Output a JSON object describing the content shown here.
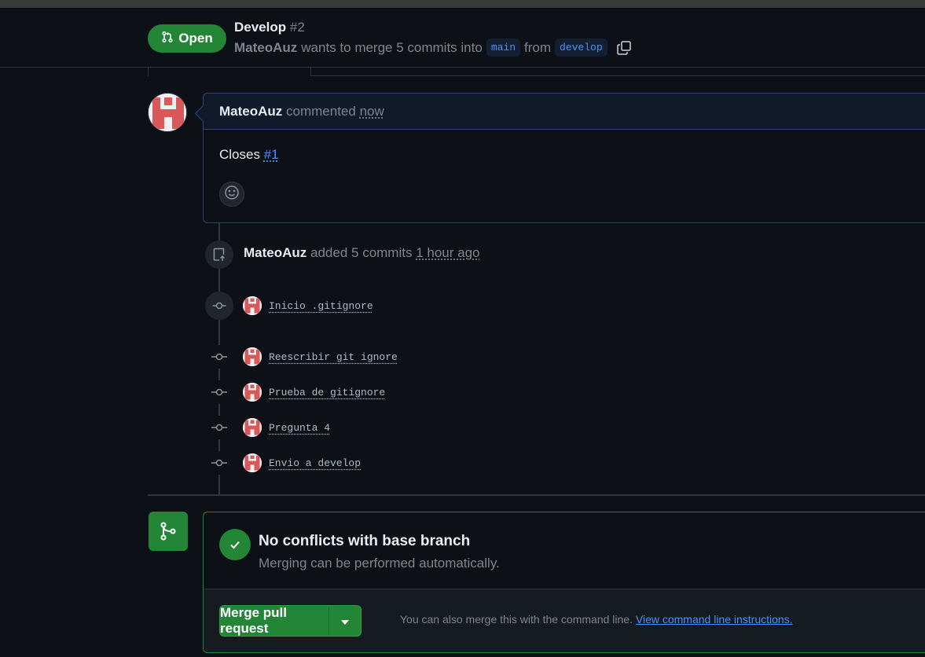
{
  "pr": {
    "state": "Open",
    "title": "Develop",
    "number": "#2",
    "author": "MateoAuz",
    "merge_text": "wants to merge 5 commits into",
    "base_branch": "main",
    "from_text": "from",
    "head_branch": "develop"
  },
  "comment": {
    "author": "MateoAuz",
    "action": "commented",
    "time": "now",
    "body_text": "Closes",
    "issue_link": "#1"
  },
  "event": {
    "author": "MateoAuz",
    "action": "added 5 commits",
    "time": "1 hour ago"
  },
  "commits": [
    {
      "message": "Inicio .gitignore"
    },
    {
      "message": "Reescribir git ignore"
    },
    {
      "message": "Prueba de gitignore"
    },
    {
      "message": "Pregunta 4"
    },
    {
      "message": "Envio a develop"
    }
  ],
  "merge": {
    "status_title": "No conflicts with base branch",
    "status_sub": "Merging can be performed automatically.",
    "button_label": "Merge pull request",
    "hint_text": "You can also merge this with the command line.",
    "hint_link": "View command line instructions."
  },
  "colors": {
    "background": "#0d1117",
    "success": "#238636",
    "link": "#4493f8",
    "muted": "#7d8590"
  },
  "icons": {
    "state": "git-pull-request-icon",
    "copy": "copy-icon",
    "emoji": "smiley-icon",
    "push": "repo-push-icon",
    "commit": "git-commit-icon",
    "merge": "git-merge-icon",
    "check": "check-icon",
    "caret": "triangle-down-icon"
  }
}
